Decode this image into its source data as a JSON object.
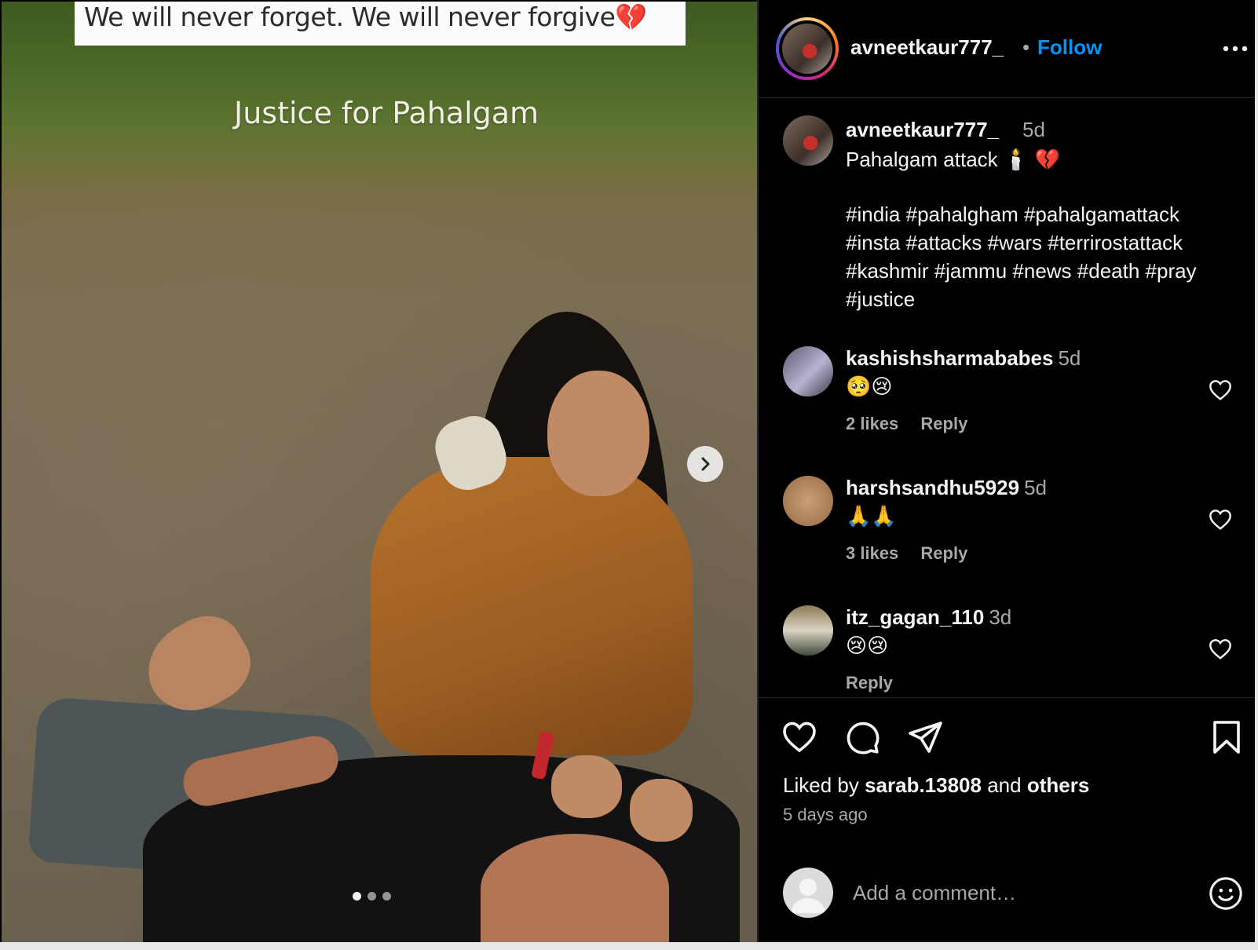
{
  "media": {
    "banner_text": "We will never forget. We will never forgive💔",
    "overlay_title": "Justice for Pahalgam",
    "next_icon": "chevron-right-icon",
    "dots": 3,
    "active_dot": 0
  },
  "header": {
    "username": "avneetkaur777_",
    "separator": "•",
    "follow_label": "Follow",
    "more_icon": "more-horizontal-icon"
  },
  "caption": {
    "username": "avneetkaur777_",
    "time": "5d",
    "text": "Pahalgam attack 🕯️ 💔",
    "hashtag_lines": [
      "#india #pahalgham #pahalgamattack",
      "#insta #attacks #wars #terrirostattack",
      "#kashmir #jammu #news #death #pray",
      "#justice"
    ]
  },
  "comments": [
    {
      "username": "kashishsharmababes",
      "time": "5d",
      "text": "🥺😢",
      "likes": "2 likes",
      "reply": "Reply"
    },
    {
      "username": "harshsandhu5929",
      "time": "5d",
      "text": "🙏🙏",
      "likes": "3 likes",
      "reply": "Reply"
    },
    {
      "username": "itz_gagan_110",
      "time": "3d",
      "text": "😢😢",
      "likes": "",
      "reply": "Reply"
    }
  ],
  "actions": {
    "icons": [
      "heart-icon",
      "comment-icon",
      "share-icon",
      "bookmark-icon"
    ],
    "liked_prefix": "Liked by ",
    "liked_user": "sarab.13808",
    "liked_and": " and ",
    "liked_others": "others",
    "time_ago": "5 days ago",
    "comment_placeholder": "Add a comment…"
  },
  "colors": {
    "accent": "#0095f6",
    "background": "#000000",
    "text": "#f5f5f5",
    "muted": "#a8a8a8"
  }
}
